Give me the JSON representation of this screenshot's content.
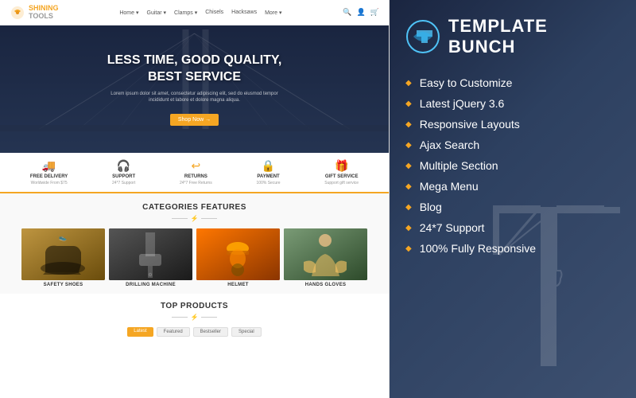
{
  "left": {
    "header": {
      "logo_name": "SHINING",
      "logo_sub": "TOOLS",
      "nav_items": [
        "Home",
        "Guitar ▾",
        "Clamps ▾",
        "Chisels",
        "Hacksaws",
        "More ▾"
      ],
      "nav_icons": [
        "🔍",
        "👤",
        "🛒"
      ]
    },
    "hero": {
      "title_line1": "LESS TIME, GOOD QUALITY,",
      "title_line2": "BEST SERVICE",
      "subtitle": "Lorem ipsum dolor sit amet, consectetur adipiscing elit, sed do eiusmod tempor incididunt et labore et dolore magna aliqua.",
      "cta_label": "Shop Now →"
    },
    "features": [
      {
        "icon": "🚚",
        "title": "FREE DELIVERY",
        "desc": "Worldwide From $75"
      },
      {
        "icon": "🎧",
        "title": "SUPPORT",
        "desc": "24*7 Support"
      },
      {
        "icon": "↩",
        "title": "RETURNS",
        "desc": "24*7 Free Returns"
      },
      {
        "icon": "🔒",
        "title": "PAYMENT",
        "desc": "100% Secure"
      },
      {
        "icon": "🎁",
        "title": "GIFT SERVICE",
        "desc": "Support gift service"
      }
    ],
    "categories": {
      "section_title": "CATEGORIES FEATURES",
      "items": [
        {
          "label": "SAFETY SHOES",
          "color": "shoes"
        },
        {
          "label": "DRILLING MACHINE",
          "color": "drilling"
        },
        {
          "label": "HELMET",
          "color": "helmet"
        },
        {
          "label": "HANDS GLOVES",
          "color": "gloves"
        }
      ]
    },
    "top_products": {
      "section_title": "TOP PRODUCTS",
      "tabs": [
        "Latest",
        "Featured",
        "Bestseller",
        "Special"
      ]
    }
  },
  "right": {
    "brand": {
      "name": "TEMPLATE BUNCH"
    },
    "features": [
      "Easy to Customize",
      "Latest jQuery 3.6",
      "Responsive Layouts",
      "Ajax Search",
      "Multiple Section",
      "Mega Menu",
      "Blog",
      "24*7 Support",
      "100% Fully Responsive"
    ]
  },
  "colors": {
    "accent": "#f5a623",
    "dark_bg": "#1a2540",
    "text_dark": "#333333",
    "text_white": "#ffffff"
  }
}
